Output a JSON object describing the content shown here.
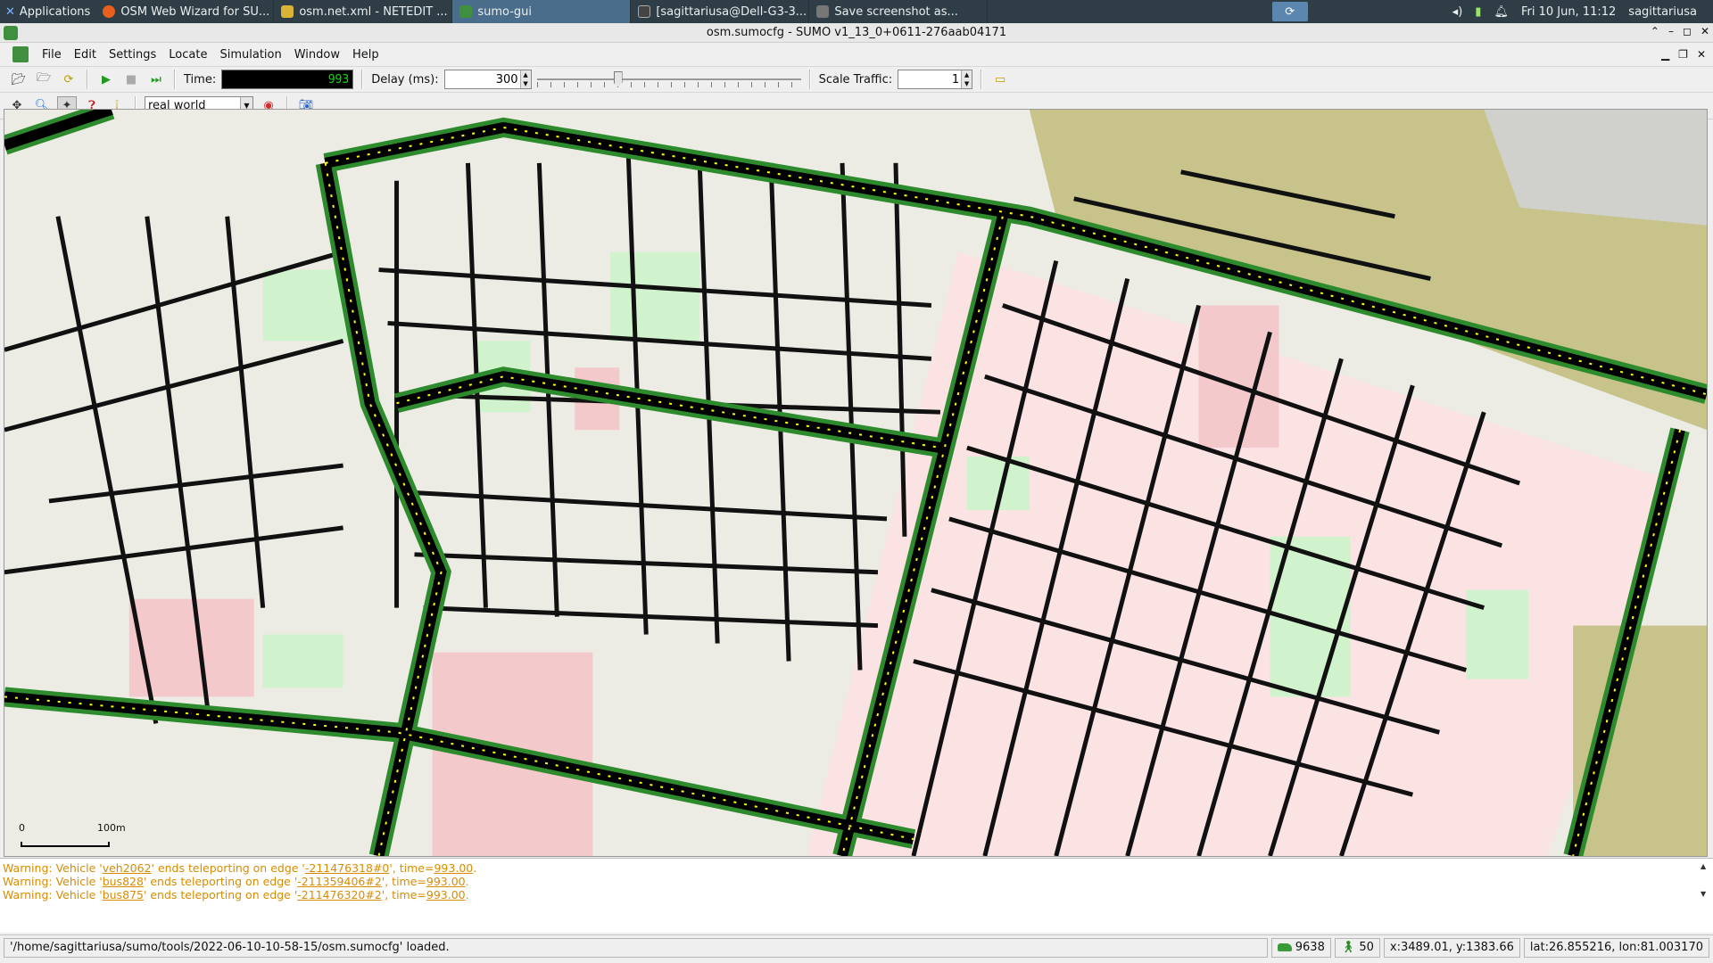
{
  "taskbar": {
    "applications_label": "Applications",
    "tasks": [
      {
        "label": "OSM Web Wizard for SU...",
        "icon": "firefox-icon",
        "color": "#e8601c",
        "active": false
      },
      {
        "label": "osm.net.xml - NETEDIT ...",
        "icon": "netedit-icon",
        "color": "#d8b336",
        "active": false
      },
      {
        "label": "sumo-gui",
        "icon": "sumo-gui-icon",
        "color": "#3f8f3f",
        "active": true
      },
      {
        "label": "[sagittariusa@Dell-G3-3...",
        "icon": "terminal-icon",
        "color": "#444444",
        "active": false
      },
      {
        "label": "Save screenshot as...",
        "icon": "camera-icon",
        "color": "#777777",
        "active": false
      }
    ],
    "clock": "Fri 10 Jun, 11:12",
    "user": "sagittariusa"
  },
  "window": {
    "title": "osm.sumocfg - SUMO v1_13_0+0611-276aab04171"
  },
  "menubar": {
    "items": [
      "File",
      "Edit",
      "Settings",
      "Locate",
      "Simulation",
      "Window",
      "Help"
    ]
  },
  "toolbar": {
    "time_label": "Time:",
    "time_value": "993",
    "delay_label": "Delay (ms):",
    "delay_value": "300",
    "scale_label": "Scale Traffic:",
    "scale_value": "1"
  },
  "viewbar": {
    "scheme": "real world"
  },
  "scale": {
    "start": "0",
    "end": "100m"
  },
  "log": {
    "lines": [
      {
        "prefix": "Warning: Vehicle '",
        "vehicle": "veh2062",
        "mid": "' ends teleporting on edge '",
        "edge": "-211476318#0",
        "suffix": "', time=",
        "time": "993.00",
        "end": "."
      },
      {
        "prefix": "Warning: Vehicle '",
        "vehicle": "bus828",
        "mid": "' ends teleporting on edge '",
        "edge": "-211359406#2",
        "suffix": "', time=",
        "time": "993.00",
        "end": "."
      },
      {
        "prefix": "Warning: Vehicle '",
        "vehicle": "bus875",
        "mid": "' ends teleporting on edge '",
        "edge": "-211476320#2",
        "suffix": "', time=",
        "time": "993.00",
        "end": "."
      }
    ]
  },
  "status": {
    "message": "'/home/sagittariusa/sumo/tools/2022-06-10-10-58-15/osm.sumocfg' loaded.",
    "vehicles": "9638",
    "persons": "50",
    "xy": "x:3489.01, y:1383.66",
    "latlon": "lat:26.855216, lon:81.003170"
  },
  "colors": {
    "road_fill": "#000000",
    "road_edge": "#2d8a2d",
    "block": "#ecece4",
    "park": "#d0f2cc",
    "residential": "#fbe3e4",
    "farmland": "#c7c38a",
    "vehicle": "#ffff00",
    "warning": "#d98c00"
  }
}
